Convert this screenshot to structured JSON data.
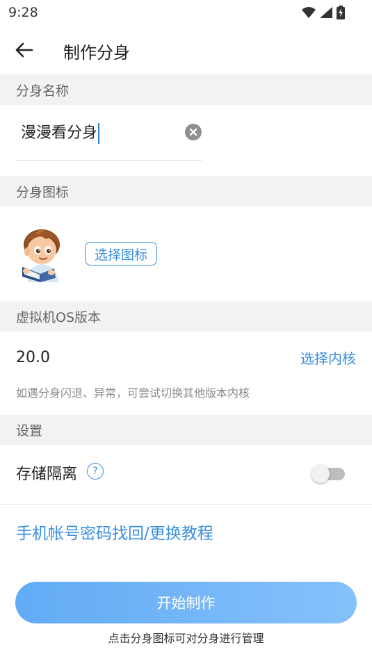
{
  "status_bar": {
    "time": "9:28",
    "icons": [
      "wifi-icon",
      "signal-icon",
      "battery-charging-icon"
    ]
  },
  "app_bar": {
    "title": "制作分身",
    "back_icon": "back-arrow-icon"
  },
  "sections": {
    "name_header": "分身名称",
    "icon_header": "分身图标",
    "os_header": "虚拟机OS版本",
    "settings_header": "设置"
  },
  "name_field": {
    "value": "漫漫看分身",
    "clear_icon": "clear-icon"
  },
  "icon_row": {
    "avatar_icon": "cartoon-boy-reading-icon",
    "choose_button": "选择图标"
  },
  "os": {
    "version": "20.0",
    "choose_kernel": "选择内核",
    "hint": "如遇分身闪退、异常，可尝试切换其他版本内核"
  },
  "settings": {
    "storage_isolation_label": "存储隔离",
    "help_icon": "?",
    "storage_isolation_enabled": false
  },
  "tutorial_link": "手机帐号密码找回/更换教程",
  "start_button": "开始制作",
  "bottom_hint": "点击分身图标可对分身进行管理",
  "colors": {
    "accent": "#3a8fe0",
    "section_bg": "#f2f2f2",
    "button_gradient_start": "#62abf5",
    "button_gradient_end": "#85c1fa"
  }
}
